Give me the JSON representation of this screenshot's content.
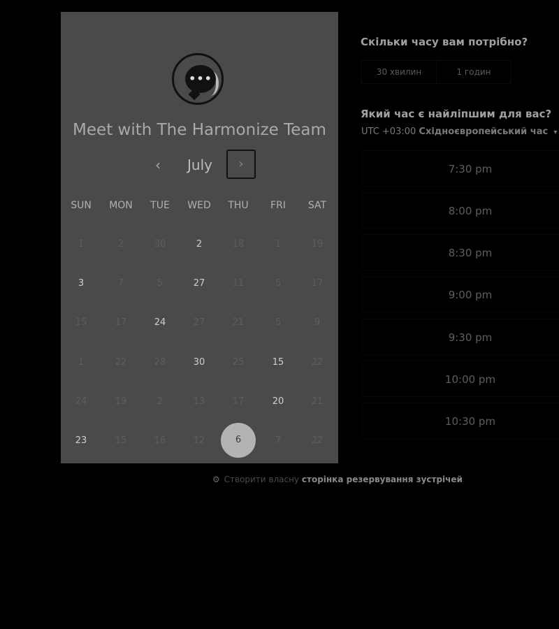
{
  "calendar": {
    "title": "Meet with The Harmonize Team",
    "month": "July",
    "prev_icon": "‹",
    "next_icon": "›",
    "weekdays": [
      "SUN",
      "MON",
      "TUE",
      "WED",
      "THU",
      "FRI",
      "SAT"
    ],
    "weeks": [
      [
        "1",
        "2",
        "30",
        "2",
        "18",
        "1",
        "19"
      ],
      [
        "3",
        "7",
        "5",
        "27",
        "11",
        "5",
        "17"
      ],
      [
        "15",
        "17",
        "24",
        "27",
        "21",
        "5",
        "9"
      ],
      [
        "1",
        "22",
        "28",
        "30",
        "25",
        "15",
        "22"
      ],
      [
        "24",
        "19",
        "2",
        "13",
        "17",
        "20",
        "21"
      ],
      [
        "23",
        "15",
        "16",
        "12",
        "6",
        "7",
        "22"
      ]
    ],
    "available": [
      [
        false,
        false,
        false,
        true,
        false,
        false,
        false
      ],
      [
        true,
        false,
        false,
        true,
        false,
        false,
        false
      ],
      [
        false,
        false,
        true,
        false,
        false,
        false,
        false
      ],
      [
        false,
        false,
        false,
        true,
        false,
        true,
        false
      ],
      [
        false,
        false,
        false,
        false,
        false,
        true,
        false
      ],
      [
        true,
        false,
        false,
        false,
        false,
        false,
        false
      ]
    ],
    "selected": {
      "week": 5,
      "day": 4
    }
  },
  "booking": {
    "duration_question": "Скільки часу вам потрібно?",
    "durations": [
      "30 хвилин",
      "1 годин"
    ],
    "time_question": "Який час є найліпшим для вас?",
    "timezone_offset": "UTC +03:00",
    "timezone_name": "Східноєвропейський час",
    "timezone_caret": "▾",
    "slots": [
      "7:30 pm",
      "8:00 pm",
      "8:30 pm",
      "9:00 pm",
      "9:30 pm",
      "10:00 pm",
      "10:30 pm"
    ]
  },
  "footer": {
    "icon": "sprocket-icon",
    "prefix": "Створити власну",
    "link": "сторінка резервування зустрічей"
  }
}
